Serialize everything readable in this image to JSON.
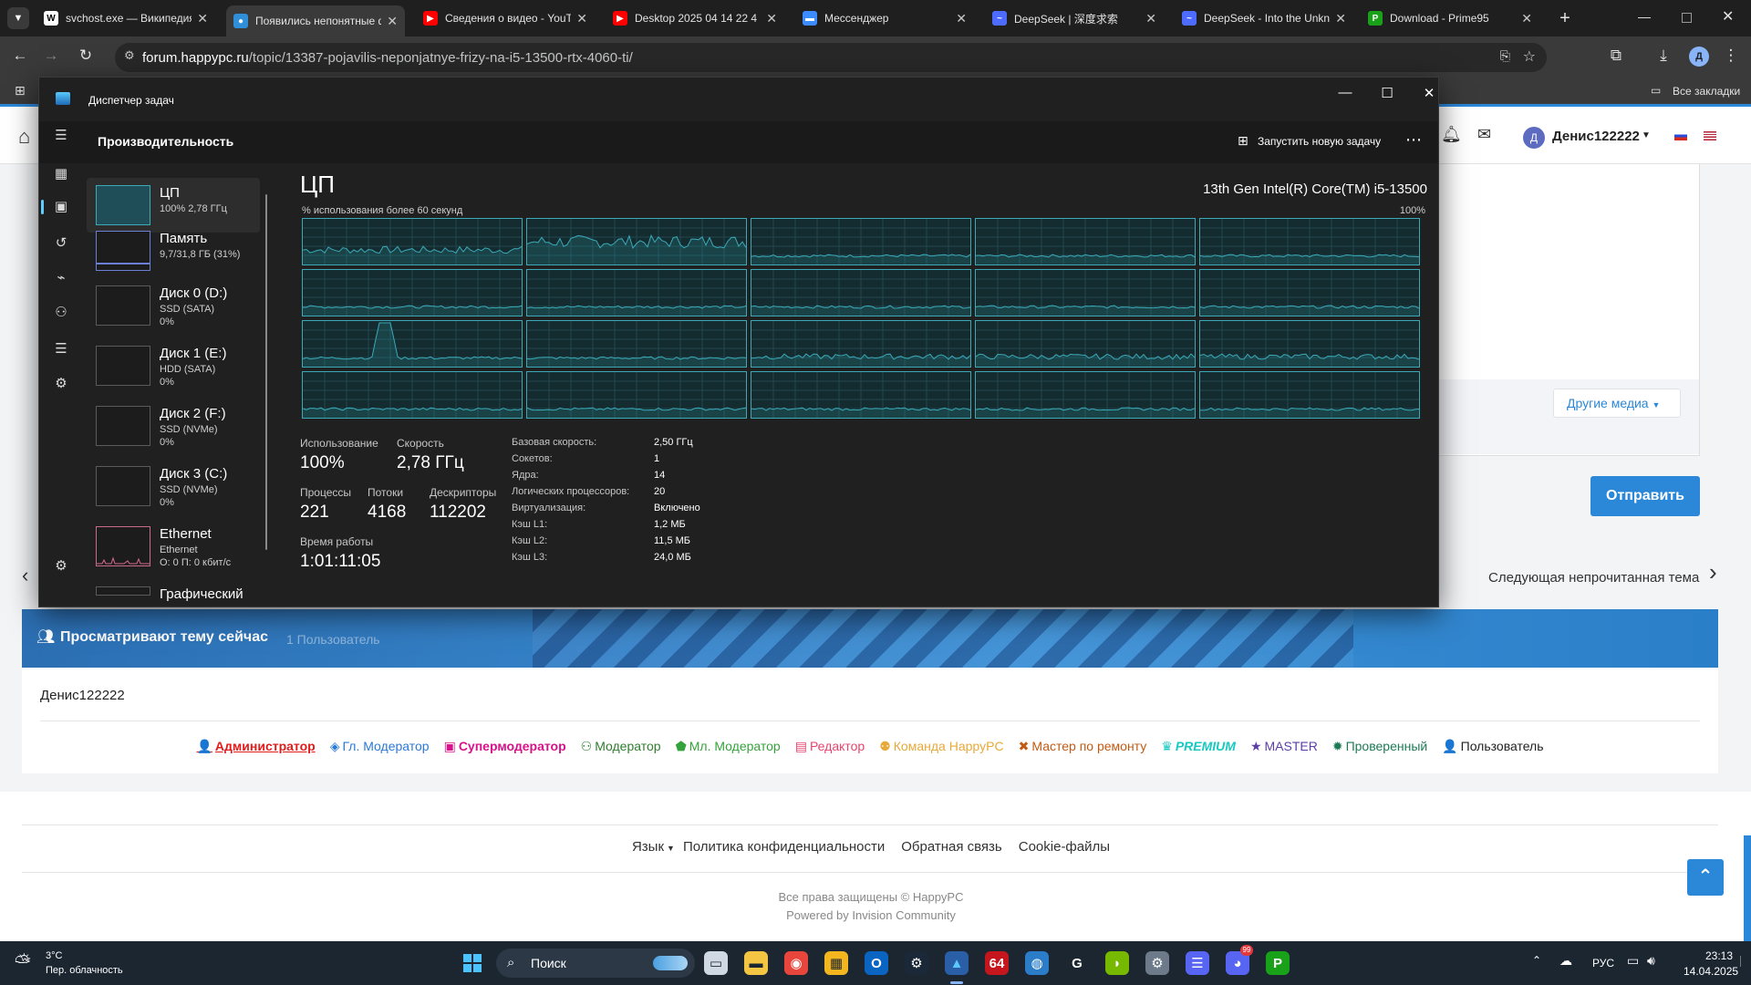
{
  "browser": {
    "tabs": [
      {
        "title": "svchost.exe — Википедия",
        "icon": "wikipedia-icon",
        "color": "#ffffff",
        "glyph": "W",
        "fg": "#000000",
        "active": false
      },
      {
        "title": "Появились непонятные ф",
        "icon": "happypc-icon",
        "color": "#2f8fd8",
        "glyph": "●",
        "fg": "#ffffff",
        "active": true
      },
      {
        "title": "Сведения о видео - YouT",
        "icon": "youtube-icon",
        "color": "#ff0000",
        "glyph": "▶",
        "fg": "#ffffff",
        "active": false
      },
      {
        "title": "Desktop 2025 04 14 22 4",
        "icon": "youtube-icon",
        "color": "#ff0000",
        "glyph": "▶",
        "fg": "#ffffff",
        "active": false
      },
      {
        "title": "Мессенджер",
        "icon": "messenger-icon",
        "color": "#3a8cff",
        "glyph": "▬",
        "fg": "#ffffff",
        "active": false
      },
      {
        "title": "DeepSeek | 深度求索",
        "icon": "deepseek-icon",
        "color": "#4d6bfe",
        "glyph": "~",
        "fg": "#ffffff",
        "active": false
      },
      {
        "title": "DeepSeek - Into the Unkn",
        "icon": "deepseek-icon",
        "color": "#4d6bfe",
        "glyph": "~",
        "fg": "#ffffff",
        "active": false
      },
      {
        "title": "Download - Prime95",
        "icon": "prime95-icon",
        "color": "#1aa11a",
        "glyph": "P",
        "fg": "#ffffff",
        "active": false
      }
    ],
    "url_host": "forum.happypc.ru",
    "url_path": "/topic/13387-pojavilis-neponjatnye-frizy-na-i5-13500-rtx-4060-ti/",
    "bookmarks_label": "Все закладки",
    "profile_initial": "Д"
  },
  "site": {
    "user_name": "Денис122222",
    "avatar_initial": "Д",
    "other_media": "Другие медиа",
    "send_button": "Отправить",
    "next_topic": "Следующая непрочитанная тема",
    "viewing_title": "Просматривают тему сейчас",
    "viewing_count": "1 Пользователь",
    "viewer": "Денис122222",
    "roles": [
      {
        "name": "Администратор",
        "color": "#e21b1b",
        "icon": "admin-icon",
        "glyph": "👤"
      },
      {
        "name": "Гл. Модератор",
        "color": "#2a79d6",
        "icon": "shield-icon",
        "glyph": "◈"
      },
      {
        "name": "Супермодератор",
        "color": "#d6138a",
        "icon": "supermod-icon",
        "glyph": "▣"
      },
      {
        "name": "Модератор",
        "color": "#2f7d2f",
        "icon": "moderator-icon",
        "glyph": "⚇"
      },
      {
        "name": "Мл. Модератор",
        "color": "#35a33b",
        "icon": "junior-mod-icon",
        "glyph": "⬟"
      },
      {
        "name": "Редактор",
        "color": "#e8436d",
        "icon": "editor-icon",
        "glyph": "▤"
      },
      {
        "name": "Команда HappyPC",
        "color": "#e6a93a",
        "icon": "team-icon",
        "glyph": "⚉"
      },
      {
        "name": "Мастер по ремонту",
        "color": "#c25a13",
        "icon": "repair-icon",
        "glyph": "✖"
      },
      {
        "name": "PREMIUM",
        "color": "#17c9c0",
        "icon": "crown-icon",
        "glyph": "♛"
      },
      {
        "name": "MASTER",
        "color": "#5a3ea6",
        "icon": "star-icon",
        "glyph": "★"
      },
      {
        "name": "Проверенный",
        "color": "#1f7a55",
        "icon": "verified-icon",
        "glyph": "✹"
      },
      {
        "name": "Пользователь",
        "color": "#222222",
        "icon": "user-icon",
        "glyph": "👤"
      }
    ],
    "footer_links": [
      "Язык",
      "Политика конфиденциальности",
      "Обратная связь",
      "Cookie-файлы"
    ],
    "copyright": "Все права защищены © HappyPC",
    "powered": "Powered by Invision Community"
  },
  "taskmgr": {
    "window_title": "Диспетчер задач",
    "section": "Производительность",
    "new_task": "Запустить новую задачу",
    "heading": "ЦП",
    "cpu_model": "13th Gen Intel(R) Core(TM) i5-13500",
    "graph_caption": "% использования более 60 секунд",
    "graph_max": "100%",
    "side_items": [
      {
        "name": "ЦП",
        "sub1": "100% 2,78 ГГц",
        "sub2": "",
        "selected": true
      },
      {
        "name": "Память",
        "sub1": "9,7/31,8 ГБ (31%)",
        "sub2": "",
        "selected": false
      },
      {
        "name": "Диск 0 (D:)",
        "sub1": "SSD (SATA)",
        "sub2": "0%",
        "selected": false
      },
      {
        "name": "Диск 1 (E:)",
        "sub1": "HDD (SATA)",
        "sub2": "0%",
        "selected": false
      },
      {
        "name": "Диск 2 (F:)",
        "sub1": "SSD (NVMe)",
        "sub2": "0%",
        "selected": false
      },
      {
        "name": "Диск 3 (C:)",
        "sub1": "SSD (NVMe)",
        "sub2": "0%",
        "selected": false
      },
      {
        "name": "Ethernet",
        "sub1": "Ethernet",
        "sub2": "О: 0 П: 0 кбит/с",
        "selected": false
      },
      {
        "name": "Графический пр",
        "sub1": "",
        "sub2": "",
        "selected": false
      }
    ],
    "stats": {
      "usage_label": "Использование",
      "usage": "100%",
      "speed_label": "Скорость",
      "speed": "2,78 ГГц",
      "proc_label": "Процессы",
      "proc": "221",
      "threads_label": "Потоки",
      "threads": "4168",
      "handles_label": "Дескрипторы",
      "handles": "112202",
      "uptime_label": "Время работы",
      "uptime": "1:01:11:05"
    },
    "specs": [
      {
        "k": "Базовая скорость:",
        "v": "2,50 ГГц"
      },
      {
        "k": "Сокетов:",
        "v": "1"
      },
      {
        "k": "Ядра:",
        "v": "14"
      },
      {
        "k": "Логических процессоров:",
        "v": "20"
      },
      {
        "k": "Виртуализация:",
        "v": "Включено"
      },
      {
        "k": "Кэш L1:",
        "v": "1,2 МБ"
      },
      {
        "k": "Кэш L2:",
        "v": "11,5 МБ"
      },
      {
        "k": "Кэш L3:",
        "v": "24,0 МБ"
      }
    ],
    "graph_color": "#3aaab8"
  },
  "taskbar": {
    "weather_temp": "3°C",
    "weather_desc": "Пер. облачность",
    "search": "Поиск",
    "lang": "РУС",
    "time": "23:13",
    "date": "14.04.2025",
    "discord_badge": "99"
  }
}
